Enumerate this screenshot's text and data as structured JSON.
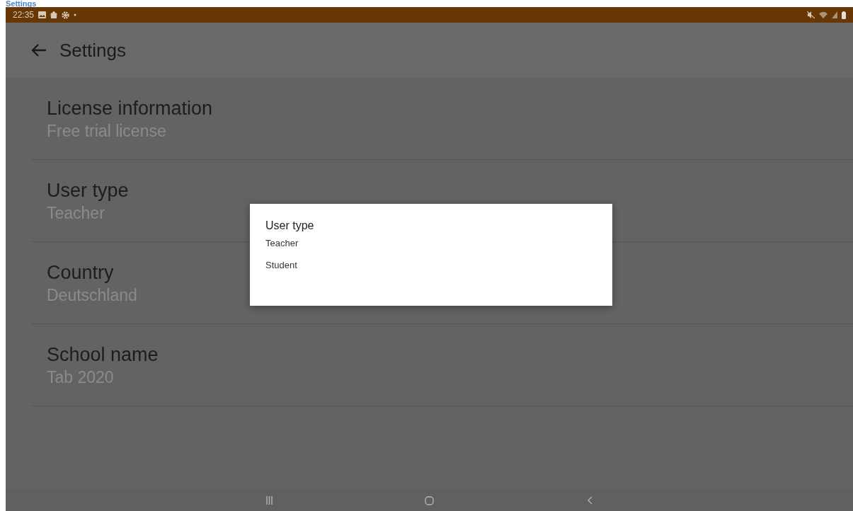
{
  "document_heading": "Settings",
  "status_bar": {
    "time": "22:35"
  },
  "app_bar": {
    "title": "Settings"
  },
  "settings": [
    {
      "title": "License information",
      "value": "Free trial license"
    },
    {
      "title": "User type",
      "value": "Teacher"
    },
    {
      "title": "Country",
      "value": "Deutschland"
    },
    {
      "title": "School name",
      "value": "Tab 2020"
    }
  ],
  "dialog": {
    "title": "User type",
    "options": [
      "Teacher",
      "Student"
    ]
  }
}
